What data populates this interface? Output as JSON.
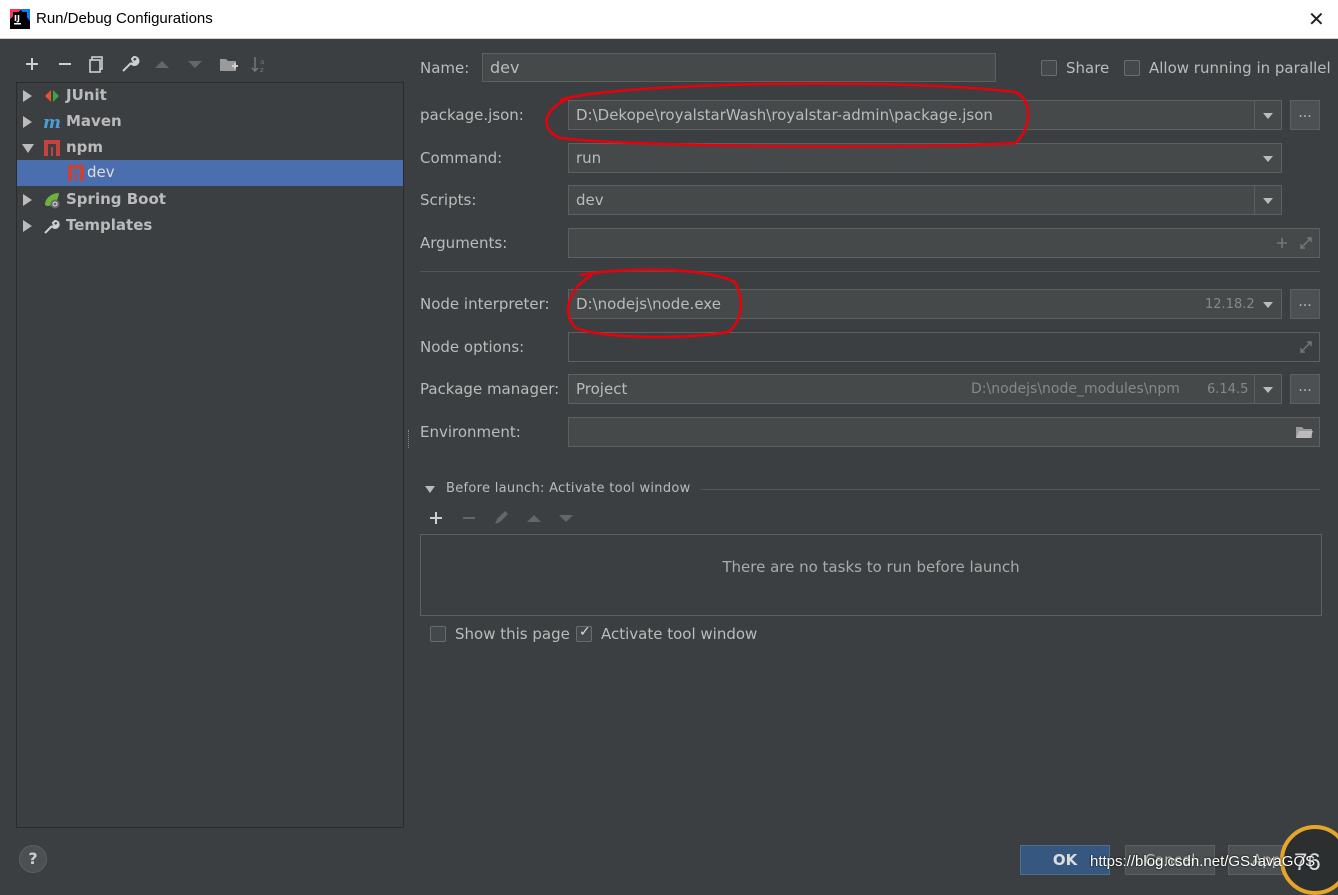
{
  "window": {
    "title": "Run/Debug Configurations",
    "close_glyph": "✕"
  },
  "toolbar": {
    "icons": [
      "add-icon",
      "remove-icon",
      "copy-icon",
      "wrench-icon",
      "move-up-icon",
      "move-down-icon",
      "new-folder-icon",
      "sort-icon"
    ]
  },
  "tree": {
    "items": [
      {
        "label": "JUnit",
        "icon": "junit-icon",
        "expanded": false
      },
      {
        "label": "Maven",
        "icon": "maven-icon",
        "expanded": false
      },
      {
        "label": "npm",
        "icon": "npm-icon",
        "expanded": true
      },
      {
        "label": "dev",
        "icon": "npm-icon",
        "selected": true
      },
      {
        "label": "Spring Boot",
        "icon": "spring-boot-icon",
        "expanded": false
      },
      {
        "label": "Templates",
        "icon": "wrench-icon",
        "expanded": false
      }
    ]
  },
  "form": {
    "name_label": "Name:",
    "name_value": "dev",
    "share_label": "Share",
    "share_checked": false,
    "parallel_label": "Allow running in parallel",
    "parallel_checked": false,
    "package_json_label": "package.json:",
    "package_json_value": "D:\\Dekope\\royalstarWash\\royalstar-admin\\package.json",
    "command_label": "Command:",
    "command_value": "run",
    "scripts_label": "Scripts:",
    "scripts_value": "dev",
    "arguments_label": "Arguments:",
    "arguments_value": "",
    "node_interpreter_label": "Node interpreter:",
    "node_interpreter_value": "D:\\nodejs\\node.exe",
    "node_interpreter_version": "12.18.2",
    "node_options_label": "Node options:",
    "node_options_value": "",
    "package_manager_label": "Package manager:",
    "package_manager_value": "Project",
    "package_manager_path": "D:\\nodejs\\node_modules\\npm",
    "package_manager_version": "6.14.5",
    "environment_label": "Environment:",
    "browse_label": "..."
  },
  "before_launch": {
    "title": "Before launch: Activate tool window",
    "empty_message": "There are no tasks to run before launch",
    "show_page_label": "Show this page",
    "show_page_checked": false,
    "activate_label": "Activate tool window",
    "activate_checked": true
  },
  "footer": {
    "help": "?",
    "ok": "OK",
    "cancel": "Cancel",
    "apply": "Apply",
    "watermark": "https://blog.csdn.net/GSJavaGOS",
    "gauge_value": "76"
  },
  "colors": {
    "accent": "#4b6eaf",
    "annotation": "#e8000b",
    "ok_button": "#365880"
  }
}
